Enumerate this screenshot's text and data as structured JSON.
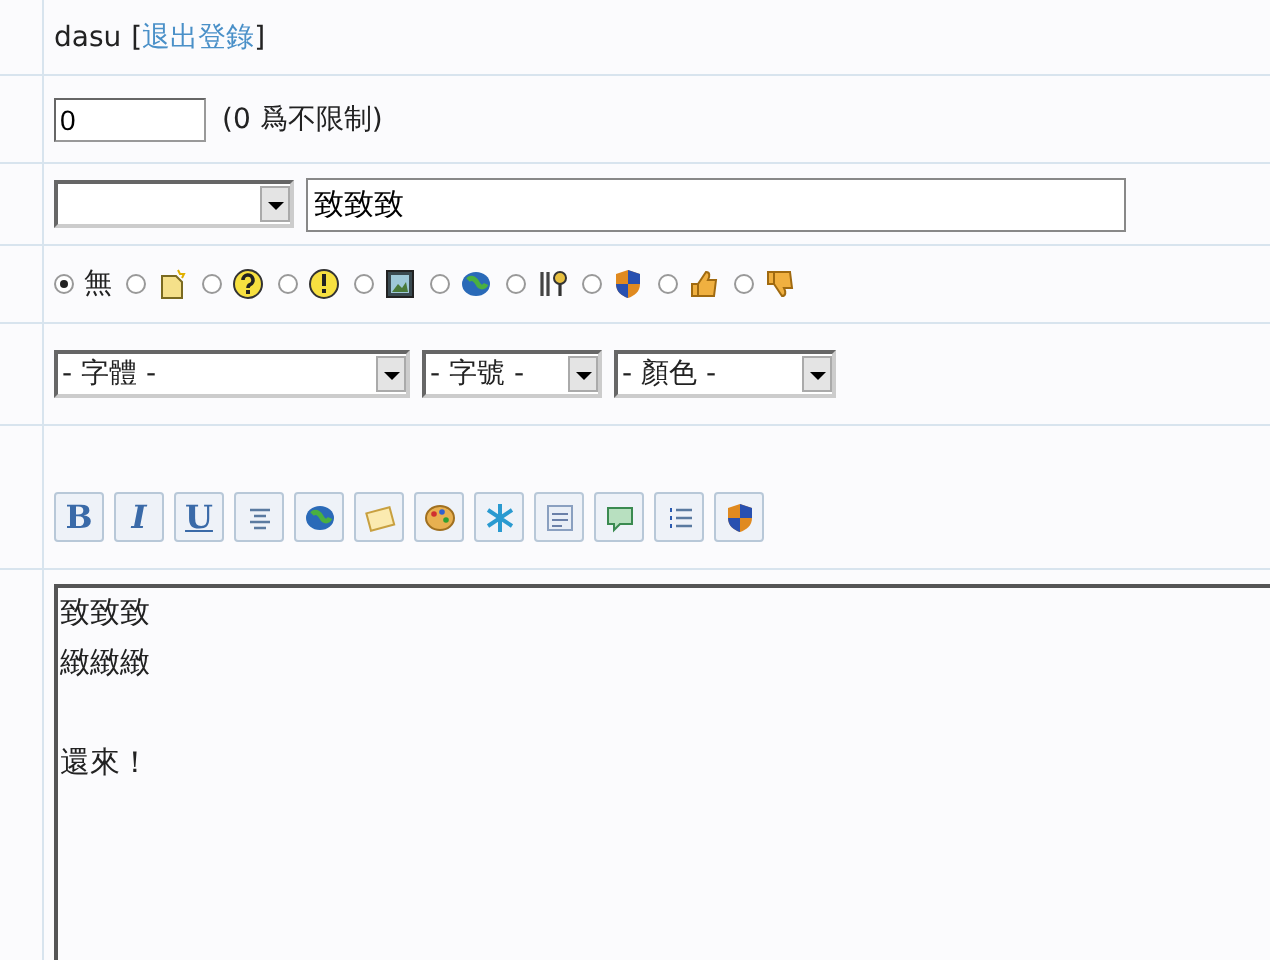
{
  "user": {
    "name": "dasu",
    "open_bracket": "[",
    "logout_link": "退出登錄",
    "close_bracket": "]"
  },
  "limit": {
    "value": "0",
    "hint": "(0 爲不限制)"
  },
  "subject": {
    "title": "致致致"
  },
  "post_icons": [
    {
      "kind": "none",
      "label": "無",
      "selected": true
    },
    {
      "kind": "note",
      "selected": false
    },
    {
      "kind": "question",
      "selected": false
    },
    {
      "kind": "exclamation",
      "selected": false
    },
    {
      "kind": "picture",
      "selected": false
    },
    {
      "kind": "globe",
      "selected": false
    },
    {
      "kind": "tools",
      "selected": false
    },
    {
      "kind": "shield",
      "selected": false
    },
    {
      "kind": "thumb-up",
      "selected": false
    },
    {
      "kind": "thumb-down",
      "selected": false
    }
  ],
  "format_selects": [
    {
      "value": "- 字體 -"
    },
    {
      "value": "- 字號 -"
    },
    {
      "value": "- 顏色 -"
    }
  ],
  "toolbar": [
    {
      "kind": "bold",
      "label": "B"
    },
    {
      "kind": "italic",
      "label": "I"
    },
    {
      "kind": "underline",
      "label": "U"
    },
    {
      "kind": "align"
    },
    {
      "kind": "globe"
    },
    {
      "kind": "envelope"
    },
    {
      "kind": "palette"
    },
    {
      "kind": "snowflake"
    },
    {
      "kind": "code"
    },
    {
      "kind": "speech"
    },
    {
      "kind": "list"
    },
    {
      "kind": "shield"
    }
  ],
  "message_paragraphs": [
    [
      "致致致",
      "緻緻緻"
    ],
    [
      "還來！"
    ]
  ]
}
